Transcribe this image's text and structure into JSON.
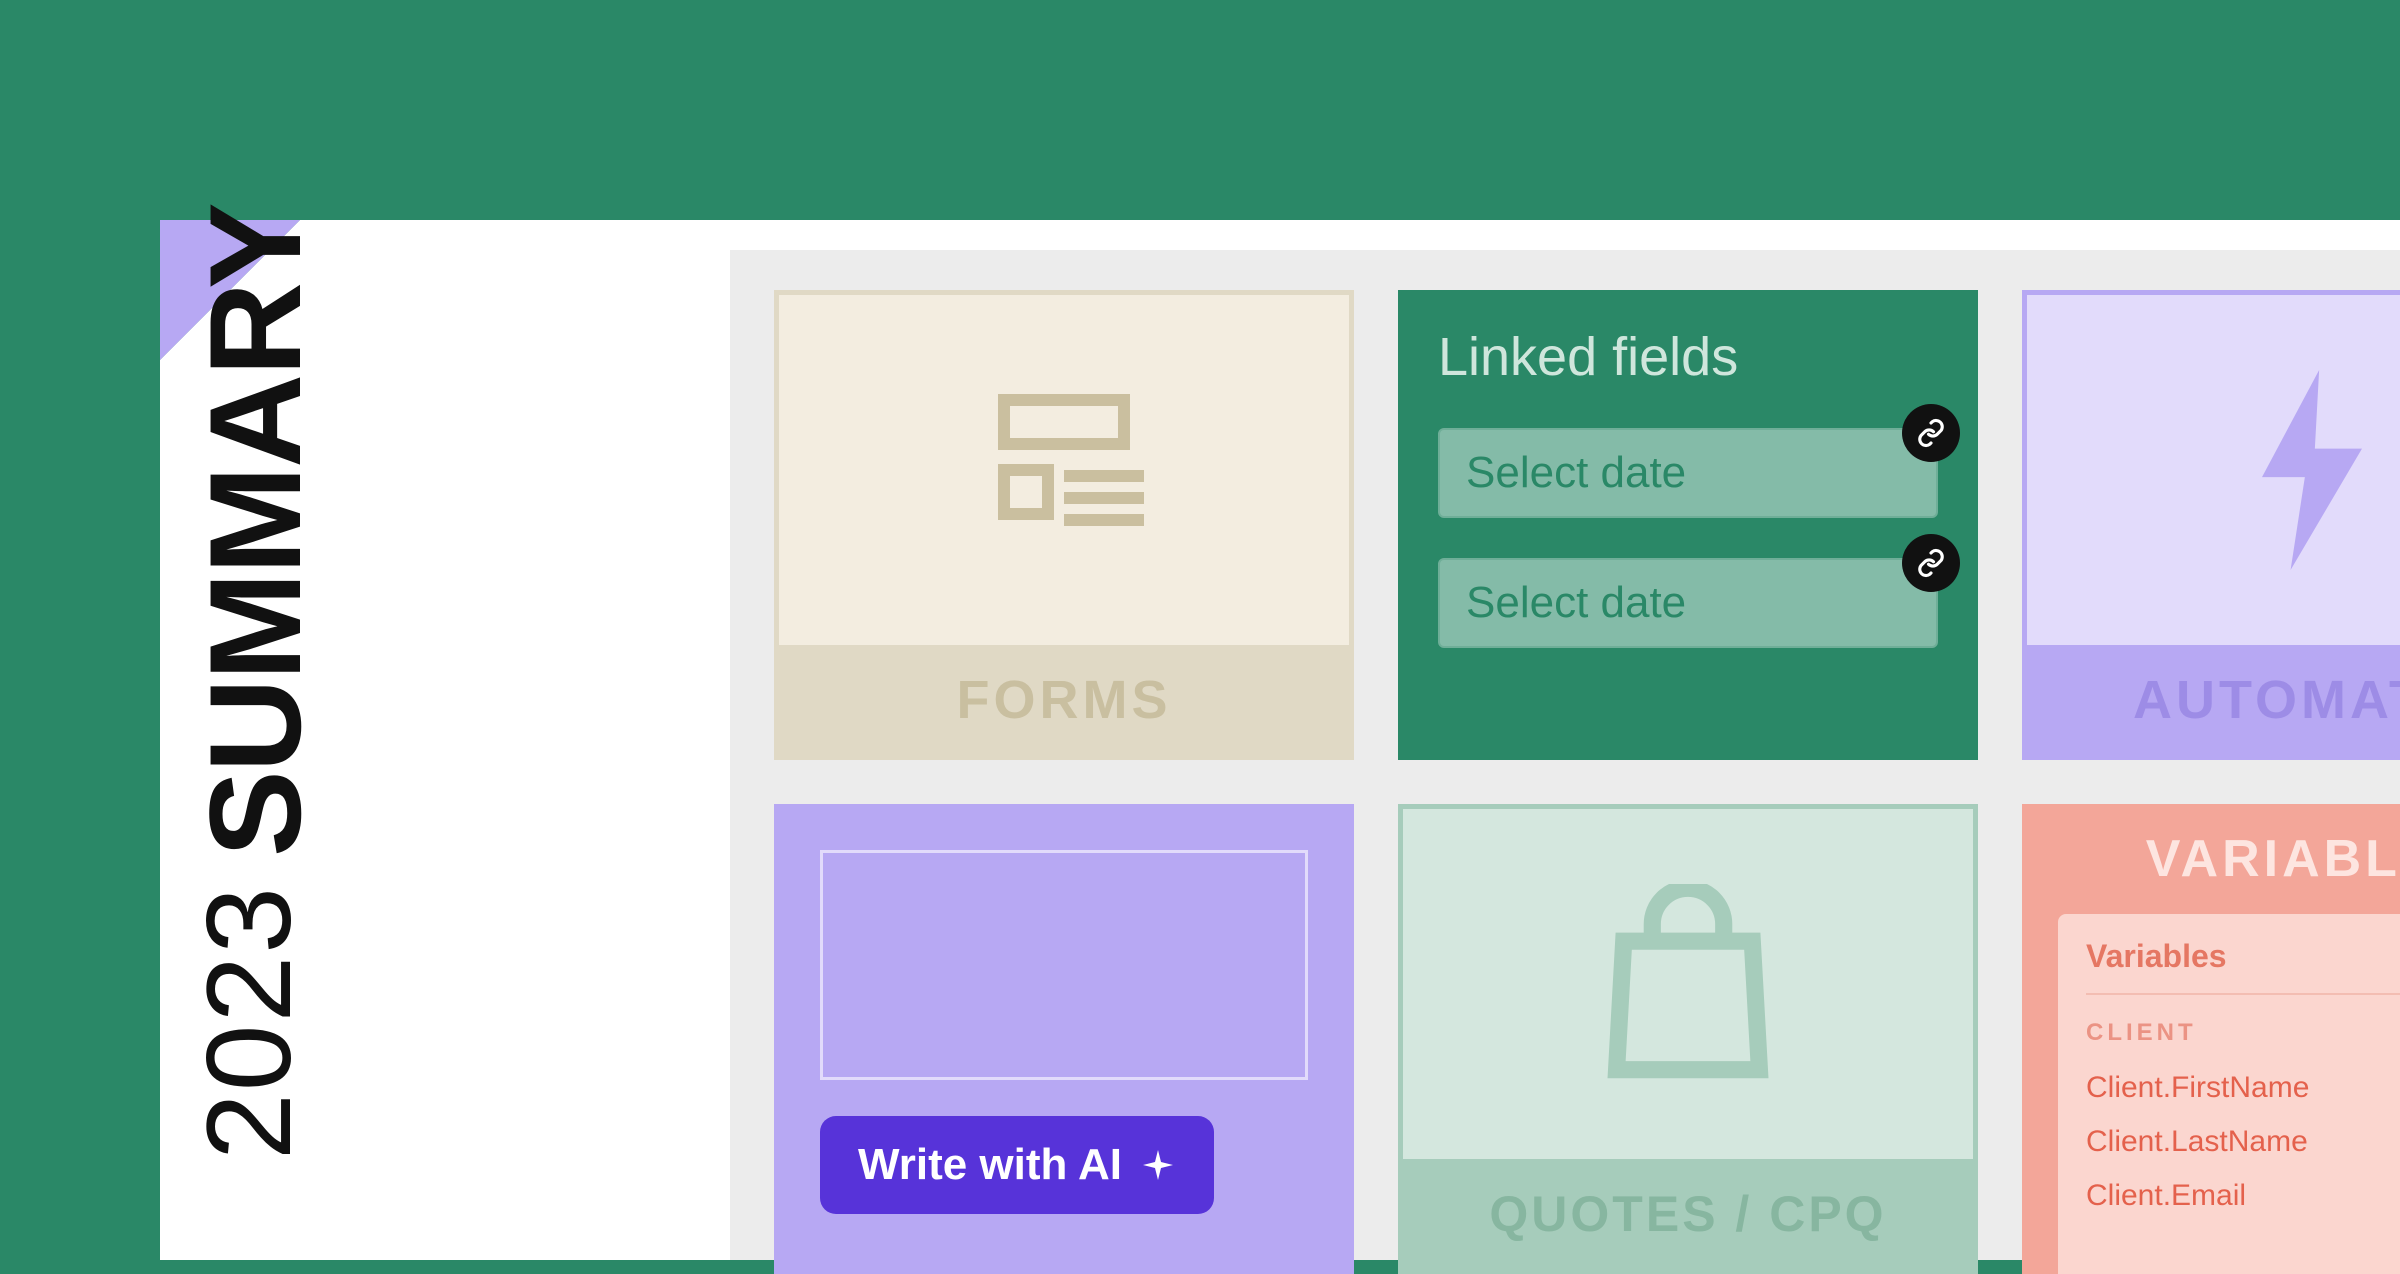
{
  "hero": {
    "year": "2023",
    "title": "SUMMARY"
  },
  "cards": {
    "forms": {
      "label": "FORMS"
    },
    "linked": {
      "title": "Linked fields",
      "field1_placeholder": "Select date",
      "field2_placeholder": "Select date"
    },
    "automation": {
      "label": "AUTOMATIO"
    },
    "ai": {
      "button_label": "Write with AI"
    },
    "quotes": {
      "label": "QUOTES / CPQ"
    },
    "variables": {
      "title": "VARIABLES",
      "panel_heading": "Variables",
      "section": "CLIENT",
      "items": [
        "Client.FirstName",
        "Client.LastName",
        "Client.Email"
      ]
    }
  },
  "colors": {
    "bg_green": "#2a8867",
    "lilac": "#b7a8f3",
    "purple_btn": "#5733d9",
    "salmon": "#f3a699"
  }
}
